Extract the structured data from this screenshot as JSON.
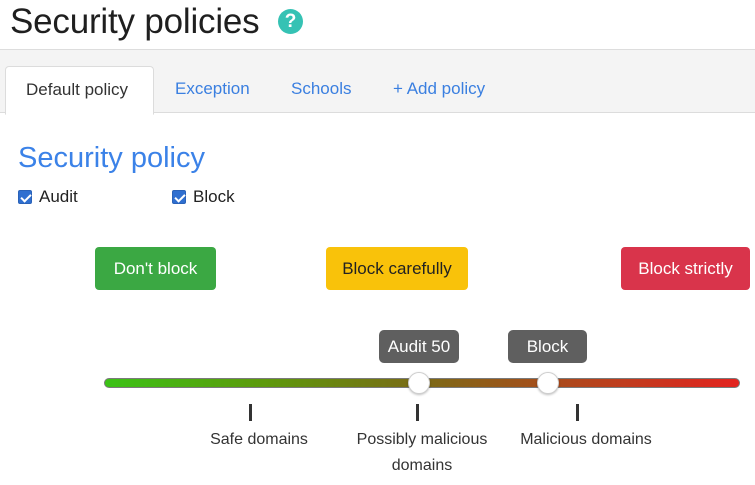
{
  "page": {
    "title": "Security policies",
    "help_icon": "question-circle-icon",
    "help_glyph": "?"
  },
  "tabs": [
    {
      "label": "Default policy",
      "active": true
    },
    {
      "label": "Exception",
      "active": false
    },
    {
      "label": "Schools",
      "active": false
    },
    {
      "label": "+ Add policy",
      "active": false
    }
  ],
  "section": {
    "title": "Security policy",
    "checkboxes": [
      {
        "label": "Audit",
        "checked": true
      },
      {
        "label": "Block",
        "checked": true
      }
    ]
  },
  "levels": [
    {
      "label": "Don't block",
      "color": "#3ba843"
    },
    {
      "label": "Block carefully",
      "color": "#f9c20a"
    },
    {
      "label": "Block strictly",
      "color": "#d9344b"
    }
  ],
  "slider": {
    "gradient_start": "#3bc216",
    "gradient_end": "#e3231f",
    "audit": {
      "label": "Audit 50",
      "value": 50
    },
    "block": {
      "label": "Block 70",
      "value": 70
    },
    "ticks": [
      {
        "label": "Safe domains"
      },
      {
        "label": "Possibly malicious domains"
      },
      {
        "label": "Malicious domains"
      }
    ]
  },
  "colors": {
    "accent": "#3b82e8",
    "help": "#35c2b4",
    "tooltip_bg": "#5f5f5f"
  }
}
